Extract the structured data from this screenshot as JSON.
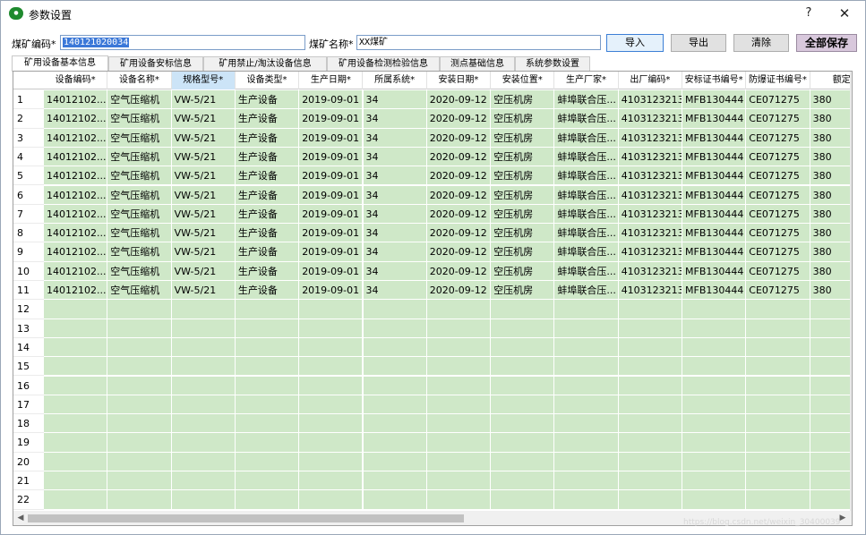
{
  "window": {
    "title": "参数设置",
    "app_icon": "app-logo-icon",
    "help_label": "?",
    "close_label": "✕"
  },
  "form": {
    "code_label": "煤矿编码*",
    "code_value": "140121020034",
    "name_label": "煤矿名称*",
    "name_value": "XX煤矿"
  },
  "toolbar": {
    "import_label": "导入",
    "export_label": "导出",
    "clear_label": "清除",
    "save_all_label": "全部保存"
  },
  "tabs": [
    {
      "label": "矿用设备基本信息",
      "active": true
    },
    {
      "label": "矿用设备安标信息",
      "active": false
    },
    {
      "label": "矿用禁止/淘汰设备信息",
      "active": false
    },
    {
      "label": "矿用设备检测检验信息",
      "active": false
    },
    {
      "label": "测点基础信息",
      "active": false
    },
    {
      "label": "系统参数设置",
      "active": false
    }
  ],
  "grid": {
    "columns": [
      "设备编码*",
      "设备名称*",
      "规格型号*",
      "设备类型*",
      "生产日期*",
      "所属系统*",
      "安装日期*",
      "安装位置*",
      "生产厂家*",
      "出厂编码*",
      "安标证书编号*",
      "防爆证书编号*",
      "额定"
    ],
    "selected_column": 2,
    "row_numbers": [
      "1",
      "2",
      "3",
      "4",
      "5",
      "6",
      "7",
      "8",
      "9",
      "10",
      "11",
      "12",
      "13",
      "14",
      "15",
      "16",
      "17",
      "18",
      "19",
      "20",
      "21",
      "22"
    ],
    "filled_rows": [
      [
        "14012102...",
        "空气压缩机",
        "VW-5/21",
        "生产设备",
        "2019-09-01",
        "34",
        "2020-09-12",
        "空压机房",
        "蚌埠联合压...",
        "4103123213",
        "MFB130444",
        "CE071275",
        "380"
      ],
      [
        "14012102...",
        "空气压缩机",
        "VW-5/21",
        "生产设备",
        "2019-09-01",
        "34",
        "2020-09-12",
        "空压机房",
        "蚌埠联合压...",
        "4103123213",
        "MFB130444",
        "CE071275",
        "380"
      ],
      [
        "14012102...",
        "空气压缩机",
        "VW-5/21",
        "生产设备",
        "2019-09-01",
        "34",
        "2020-09-12",
        "空压机房",
        "蚌埠联合压...",
        "4103123213",
        "MFB130444",
        "CE071275",
        "380"
      ],
      [
        "14012102...",
        "空气压缩机",
        "VW-5/21",
        "生产设备",
        "2019-09-01",
        "34",
        "2020-09-12",
        "空压机房",
        "蚌埠联合压...",
        "4103123213",
        "MFB130444",
        "CE071275",
        "380"
      ],
      [
        "14012102...",
        "空气压缩机",
        "VW-5/21",
        "生产设备",
        "2019-09-01",
        "34",
        "2020-09-12",
        "空压机房",
        "蚌埠联合压...",
        "4103123213",
        "MFB130444",
        "CE071275",
        "380"
      ],
      [
        "14012102...",
        "空气压缩机",
        "VW-5/21",
        "生产设备",
        "2019-09-01",
        "34",
        "2020-09-12",
        "空压机房",
        "蚌埠联合压...",
        "4103123213",
        "MFB130444",
        "CE071275",
        "380"
      ],
      [
        "14012102...",
        "空气压缩机",
        "VW-5/21",
        "生产设备",
        "2019-09-01",
        "34",
        "2020-09-12",
        "空压机房",
        "蚌埠联合压...",
        "4103123213",
        "MFB130444",
        "CE071275",
        "380"
      ],
      [
        "14012102...",
        "空气压缩机",
        "VW-5/21",
        "生产设备",
        "2019-09-01",
        "34",
        "2020-09-12",
        "空压机房",
        "蚌埠联合压...",
        "4103123213",
        "MFB130444",
        "CE071275",
        "380"
      ],
      [
        "14012102...",
        "空气压缩机",
        "VW-5/21",
        "生产设备",
        "2019-09-01",
        "34",
        "2020-09-12",
        "空压机房",
        "蚌埠联合压...",
        "4103123213",
        "MFB130444",
        "CE071275",
        "380"
      ],
      [
        "14012102...",
        "空气压缩机",
        "VW-5/21",
        "生产设备",
        "2019-09-01",
        "34",
        "2020-09-12",
        "空压机房",
        "蚌埠联合压...",
        "4103123213",
        "MFB130444",
        "CE071275",
        "380"
      ],
      [
        "14012102...",
        "空气压缩机",
        "VW-5/21",
        "生产设备",
        "2019-09-01",
        "34",
        "2020-09-12",
        "空压机房",
        "蚌埠联合压...",
        "4103123213",
        "MFB130444",
        "CE071275",
        "380"
      ]
    ]
  },
  "scrollbars": {
    "up": "▲",
    "down": "▼",
    "left": "◀",
    "right": "▶"
  },
  "watermark": "https://blog.csdn.net/weixin_30400039",
  "colors": {
    "row_fill": "#cfe8c8",
    "selection": "#3b78d8",
    "save_button": "#d8c8dc"
  }
}
